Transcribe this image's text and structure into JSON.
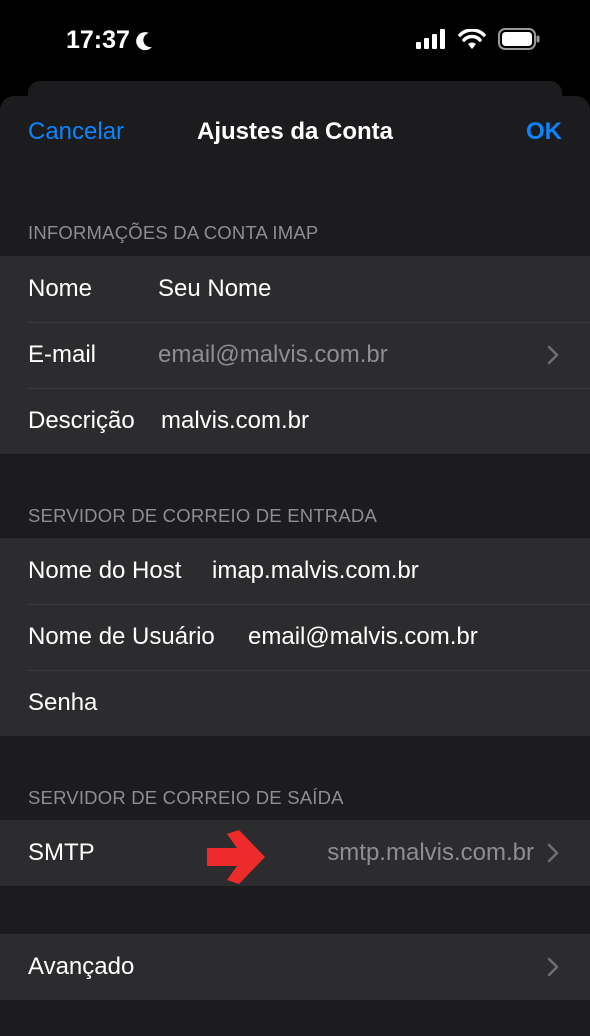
{
  "status": {
    "time": "17:37"
  },
  "nav": {
    "cancel": "Cancelar",
    "title": "Ajustes da Conta",
    "ok": "OK"
  },
  "imap_section": {
    "header": "INFORMAÇÕES DA CONTA IMAP",
    "name_label": "Nome",
    "name_value": "Seu Nome",
    "email_label": "E-mail",
    "email_value": "email@malvis.com.br",
    "desc_label": "Descrição",
    "desc_value": "malvis.com.br"
  },
  "incoming_section": {
    "header": "SERVIDOR DE CORREIO DE ENTRADA",
    "host_label": "Nome do Host",
    "host_value": "imap.malvis.com.br",
    "user_label": "Nome de Usuário",
    "user_value": "email@malvis.com.br",
    "password_label": "Senha"
  },
  "outgoing_section": {
    "header": "SERVIDOR DE CORREIO DE SAÍDA",
    "smtp_label": "SMTP",
    "smtp_value": "smtp.malvis.com.br"
  },
  "advanced": {
    "label": "Avançado"
  },
  "colors": {
    "accent": "#0a84ff",
    "arrow": "#ee2b2b",
    "muted": "#8d8d93"
  }
}
